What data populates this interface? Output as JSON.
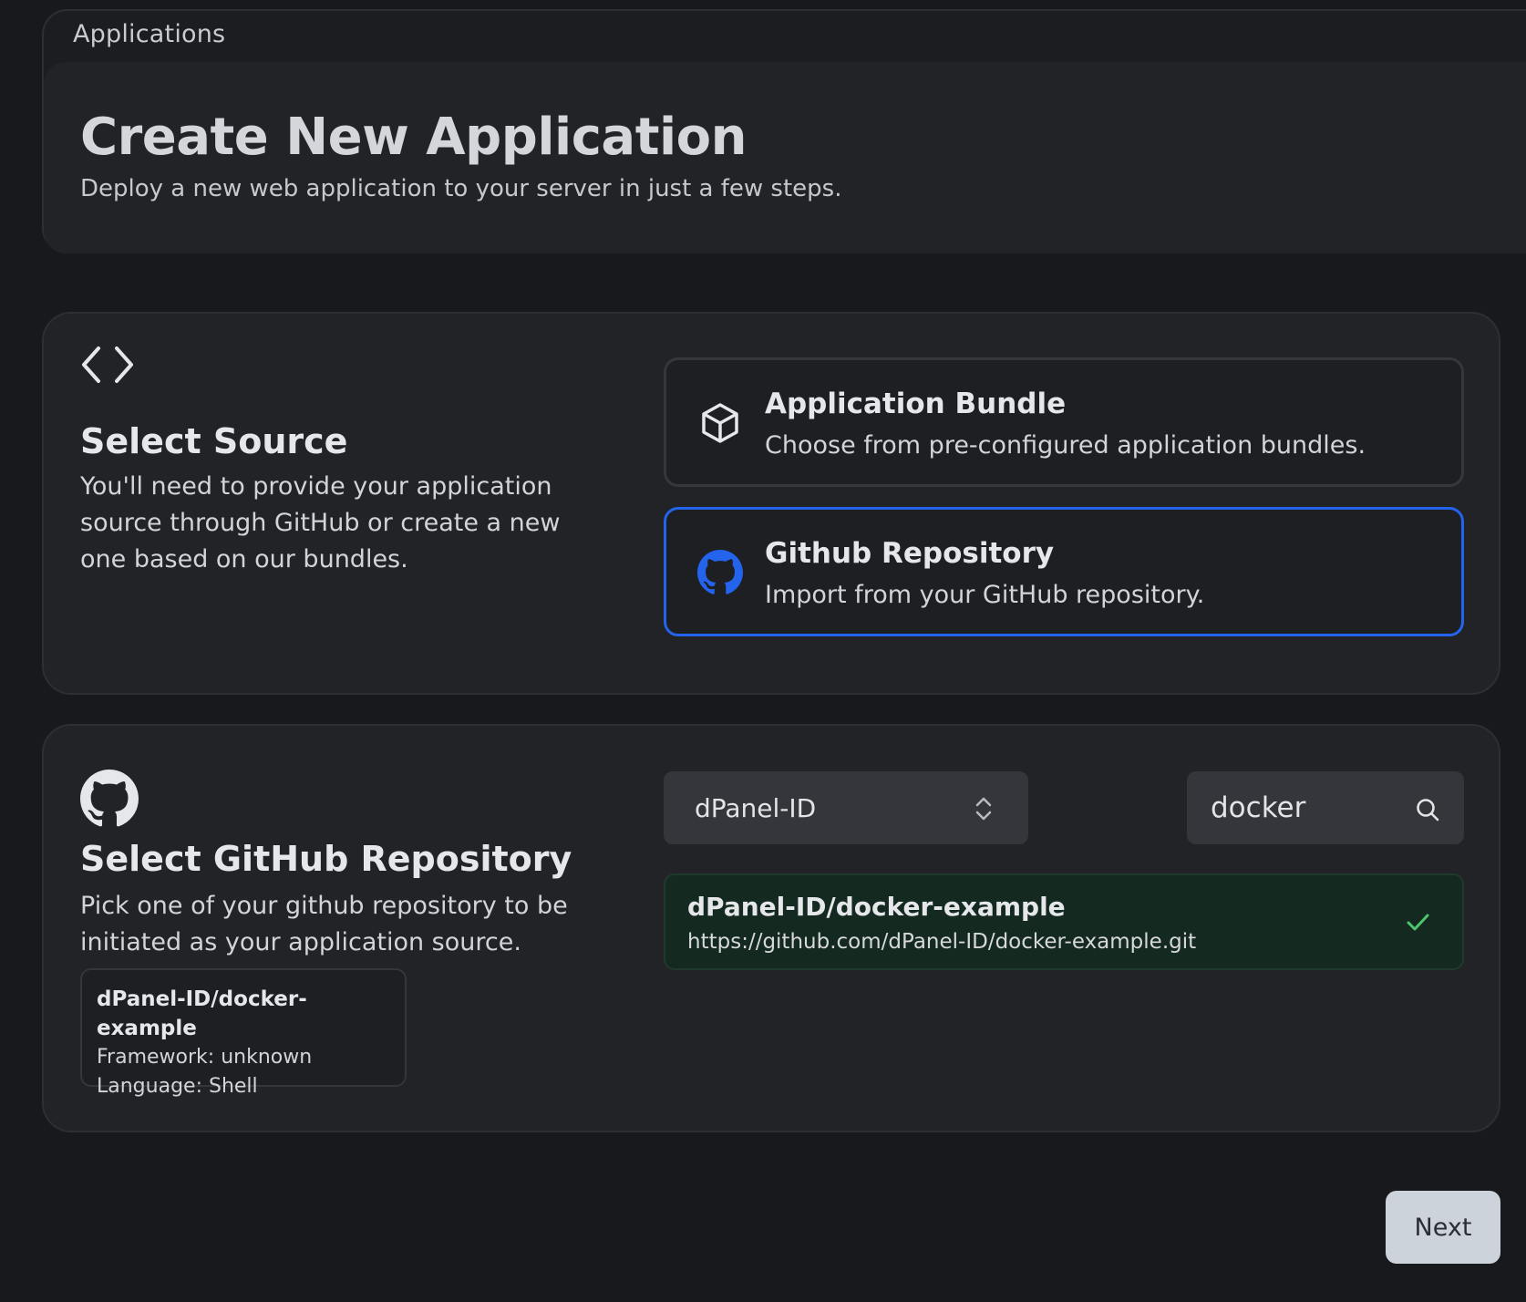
{
  "breadcrumb": {
    "label": "Applications"
  },
  "header": {
    "title": "Create New Application",
    "subtitle": "Deploy a new web application to your server in just a few steps."
  },
  "source_section": {
    "icon": "code-brackets-icon",
    "title": "Select Source",
    "description": "You'll need to provide your application source through GitHub or create a new one based on our bundles.",
    "options": [
      {
        "icon": "package-cube-icon",
        "title": "Application Bundle",
        "description": "Choose from pre-configured application bundles.",
        "selected": false
      },
      {
        "icon": "github-icon",
        "title": "Github Repository",
        "description": "Import from your GitHub repository.",
        "selected": true
      }
    ]
  },
  "repo_section": {
    "icon": "github-icon",
    "title": "Select GitHub Repository",
    "description": "Pick one of your github repository to be initiated as your application source.",
    "org_select": {
      "value": "dPanel-ID",
      "icon": "chevron-up-down-icon"
    },
    "search": {
      "value": "docker",
      "icon": "search-icon"
    },
    "results": [
      {
        "name": "dPanel-ID/docker-example",
        "url": "https://github.com/dPanel-ID/docker-example.git",
        "selected": true,
        "icon": "check-icon"
      }
    ],
    "summary": {
      "name": "dPanel-ID/docker-example",
      "framework": "Framework: unknown",
      "language": "Language: Shell"
    }
  },
  "footer": {
    "next_label": "Next"
  },
  "colors": {
    "background": "#18191d",
    "card": "#222327",
    "selected_border": "#2463eb",
    "selected_result_bg": "#14291f",
    "check": "#4ec46b",
    "next_button_bg": "#cdd3da"
  }
}
